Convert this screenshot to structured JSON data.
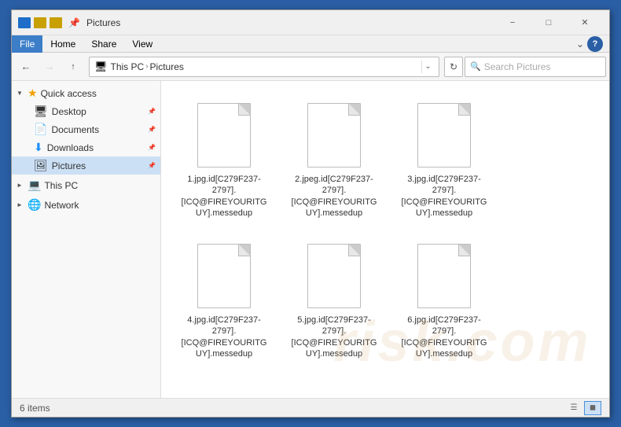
{
  "window": {
    "title": "Pictures",
    "icon": "📁"
  },
  "menu": {
    "items": [
      "File",
      "Home",
      "Share",
      "View"
    ]
  },
  "toolbar": {
    "back_disabled": false,
    "forward_disabled": true,
    "address": {
      "parts": [
        "This PC",
        "Pictures"
      ]
    },
    "search_placeholder": "Search Pictures"
  },
  "sidebar": {
    "quick_access_label": "Quick access",
    "items": [
      {
        "name": "Desktop",
        "icon": "🖥",
        "pinned": true
      },
      {
        "name": "Documents",
        "icon": "📄",
        "pinned": true
      },
      {
        "name": "Downloads",
        "icon": "⬇",
        "pinned": true
      },
      {
        "name": "Pictures",
        "icon": "🖼",
        "pinned": true,
        "selected": true
      }
    ],
    "this_pc_label": "This PC",
    "network_label": "Network"
  },
  "files": [
    {
      "name": "1.jpg.id[C279F237-2797].[ICQ@FIREYOURITGUY].messedup"
    },
    {
      "name": "2.jpeg.id[C279F237-2797].[ICQ@FIREYOURITGUY].messedup"
    },
    {
      "name": "3.jpg.id[C279F237-2797].[ICQ@FIREYOURITGUY].messedup"
    },
    {
      "name": "4.jpg.id[C279F237-2797].[ICQ@FIREYOURITGUY].messedup"
    },
    {
      "name": "5.jpg.id[C279F237-2797].[ICQ@FIREYOURITGUY].messedup"
    },
    {
      "name": "6.jpg.id[C279F237-2797].[ICQ@FIREYOURITGUY].messedup"
    }
  ],
  "status": {
    "item_count": "6 items"
  },
  "watermark": "risk.com"
}
